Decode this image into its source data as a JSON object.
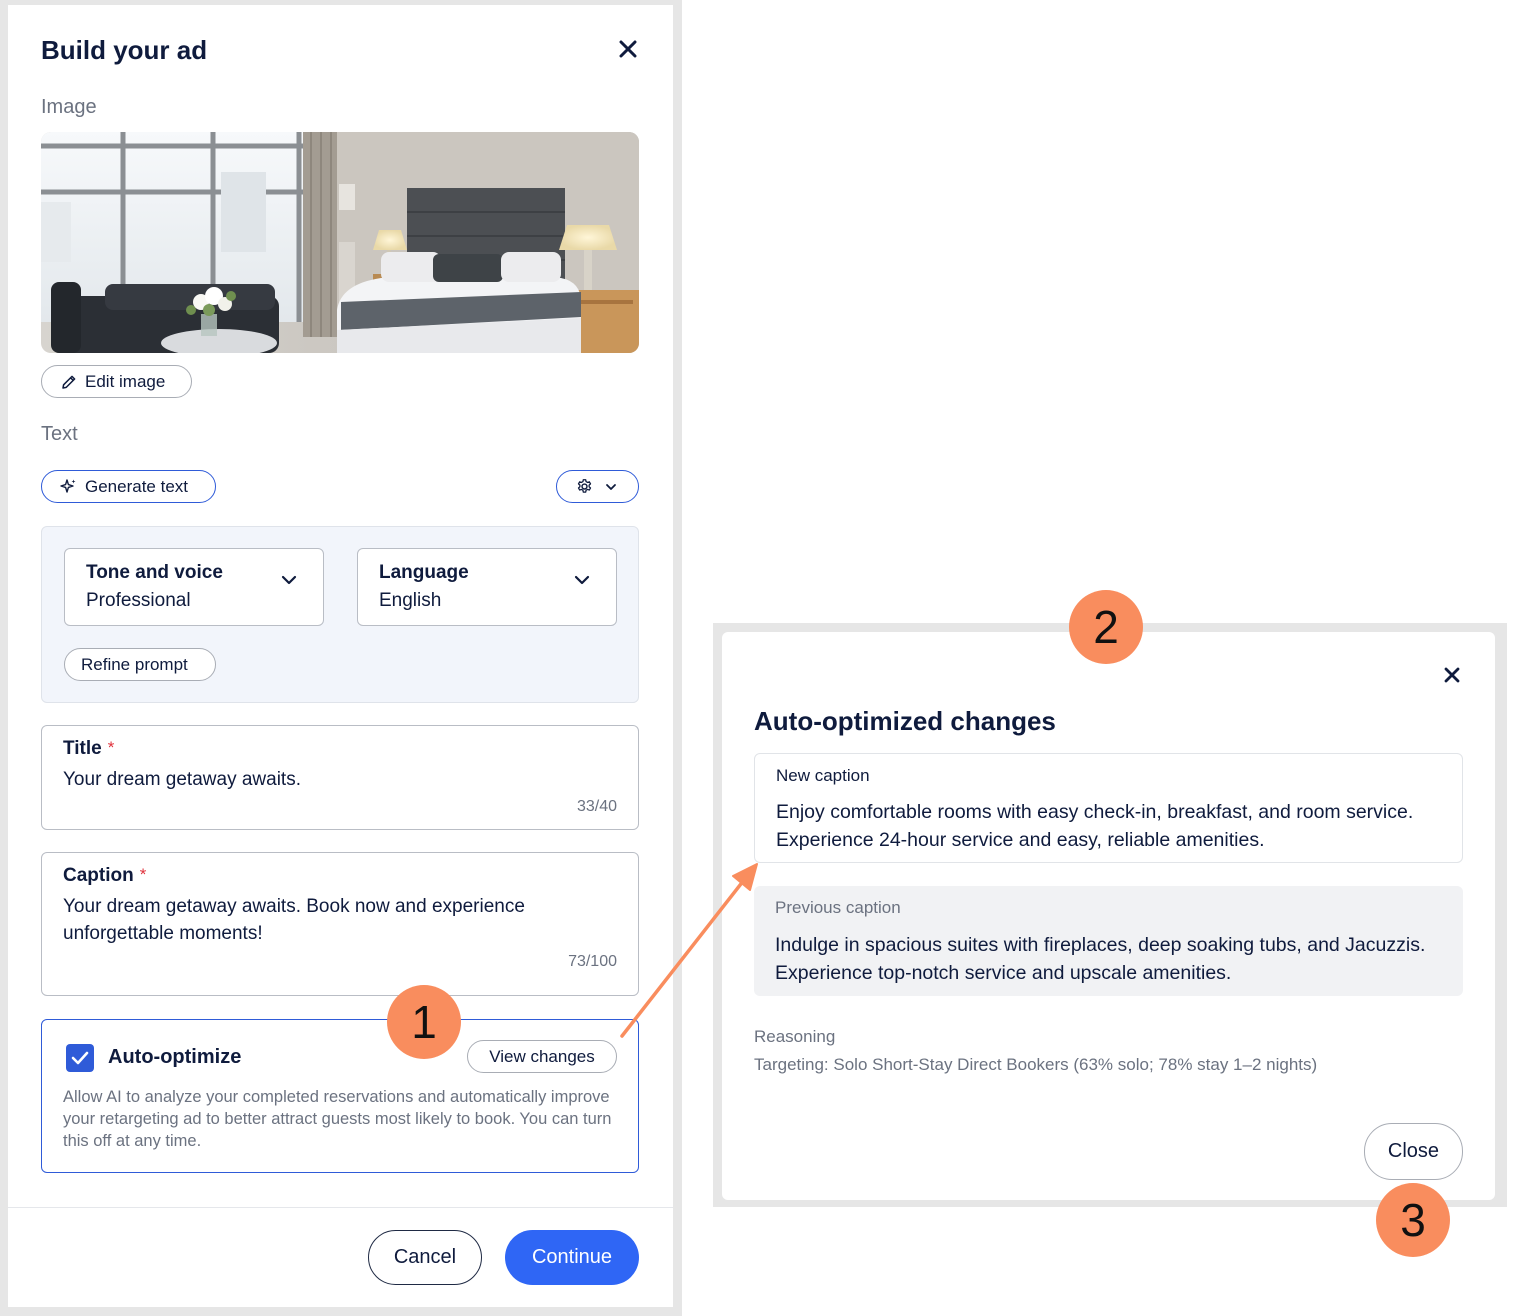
{
  "left_panel": {
    "title": "Build your ad",
    "image_section_label": "Image",
    "edit_image_label": "Edit image",
    "text_section_label": "Text",
    "generate_text_label": "Generate text",
    "tone": {
      "label": "Tone and voice",
      "value": "Professional"
    },
    "language": {
      "label": "Language",
      "value": "English"
    },
    "refine_prompt_label": "Refine prompt",
    "title_field": {
      "label": "Title",
      "required_mark": "*",
      "value": "Your dream getaway awaits.",
      "count": "33/40"
    },
    "caption_field": {
      "label": "Caption",
      "required_mark": "*",
      "value": "Your dream getaway awaits. Book now and experience unforgettable moments!",
      "count": "73/100"
    },
    "auto_optimize": {
      "label": "Auto-optimize",
      "checked": true,
      "view_changes_label": "View changes",
      "description": "Allow AI to analyze your completed reservations and automatically improve your retargeting ad to better attract guests most likely to book. You can turn this off at any time."
    },
    "cancel_label": "Cancel",
    "continue_label": "Continue"
  },
  "modal": {
    "title": "Auto-optimized changes",
    "new_caption_label": "New caption",
    "new_caption_text": "Enjoy comfortable rooms with easy check-in, breakfast, and room service. Experience 24-hour service and easy, reliable amenities.",
    "previous_caption_label": "Previous caption",
    "previous_caption_text": "Indulge in spacious suites with fireplaces, deep soaking tubs, and Jacuzzis. Experience top-notch service and upscale amenities.",
    "reasoning_label": "Reasoning",
    "reasoning_text": "Targeting: Solo Short-Stay Direct Bookers (63% solo; 78% stay 1–2 nights)",
    "close_label": "Close"
  },
  "annotations": {
    "step1": "1",
    "step2": "2",
    "step3": "3"
  },
  "icons": {
    "close": "close-icon",
    "pencil": "pencil-icon",
    "sparkle": "sparkle-icon",
    "gear": "gear-icon",
    "chevron": "chevron-down-icon",
    "check": "checkmark-icon"
  },
  "colors": {
    "accent_blue": "#2f66f5",
    "annotation_orange": "#f98d5e",
    "required_red": "#e0323c",
    "text_dark": "#0f1b3d",
    "text_muted": "#6b7280"
  }
}
